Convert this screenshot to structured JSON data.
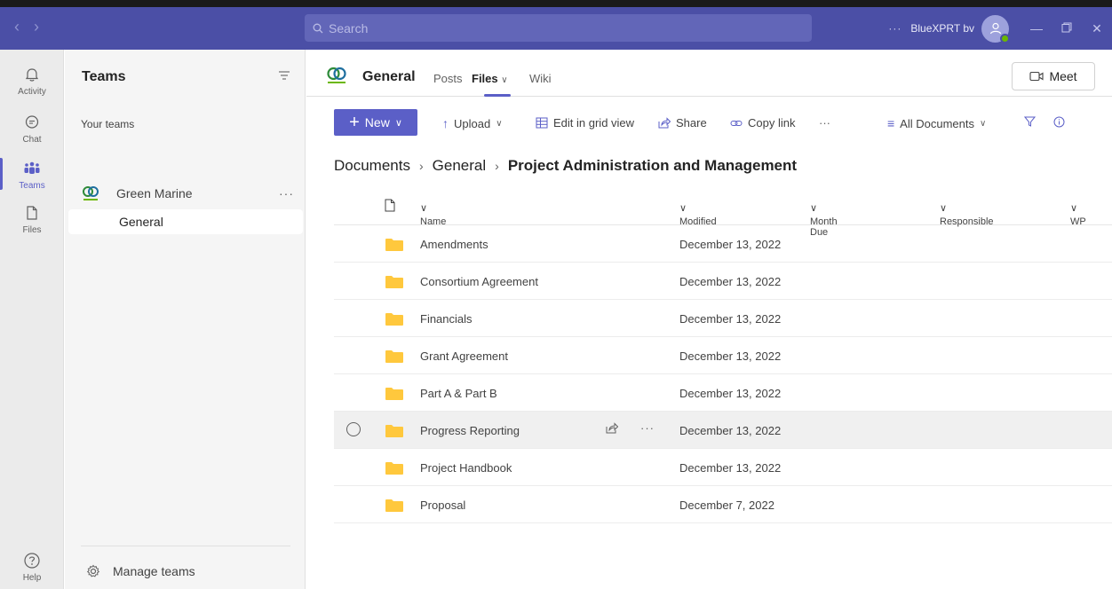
{
  "titlebar": {
    "search_placeholder": "Search",
    "more": "···",
    "org_name": "BlueXPRT bv"
  },
  "rail": {
    "items": [
      {
        "label": "Activity",
        "icon": "bell-icon"
      },
      {
        "label": "Chat",
        "icon": "chat-icon"
      },
      {
        "label": "Teams",
        "icon": "teams-icon"
      },
      {
        "label": "Files",
        "icon": "file-icon"
      },
      {
        "label": "Help",
        "icon": "help-icon"
      }
    ]
  },
  "panel": {
    "title": "Teams",
    "section": "Your teams",
    "team_name": "Green Marine",
    "team_more": "···",
    "channel": "General",
    "manage": "Manage teams"
  },
  "header": {
    "channel_name": "General",
    "tabs": [
      {
        "label": "Posts"
      },
      {
        "label": "Files"
      },
      {
        "label": "Wiki"
      }
    ],
    "meet_label": "Meet"
  },
  "cmdbar": {
    "new": "New",
    "upload": "Upload",
    "edit_grid": "Edit in grid view",
    "share": "Share",
    "copy_link": "Copy link",
    "more": "···",
    "view": "All Documents"
  },
  "breadcrumb": [
    "Documents",
    "General",
    "Project Administration and Management"
  ],
  "columns": {
    "name": "Name",
    "modified": "Modified",
    "month_due": "Month Due",
    "responsible": "Responsible",
    "wp": "WP"
  },
  "files": [
    {
      "name": "Amendments",
      "modified": "December 13, 2022"
    },
    {
      "name": "Consortium Agreement",
      "modified": "December 13, 2022"
    },
    {
      "name": "Financials",
      "modified": "December 13, 2022"
    },
    {
      "name": "Grant Agreement",
      "modified": "December 13, 2022"
    },
    {
      "name": "Part A & Part B",
      "modified": "December 13, 2022"
    },
    {
      "name": "Progress Reporting",
      "modified": "December 13, 2022"
    },
    {
      "name": "Project Handbook",
      "modified": "December 13, 2022"
    },
    {
      "name": "Proposal",
      "modified": "December 7, 2022"
    }
  ],
  "row_more": "···",
  "colors": {
    "accent": "#5b5fc7",
    "titlebar": "#4b4fa6",
    "folder": "#ffc83d"
  }
}
